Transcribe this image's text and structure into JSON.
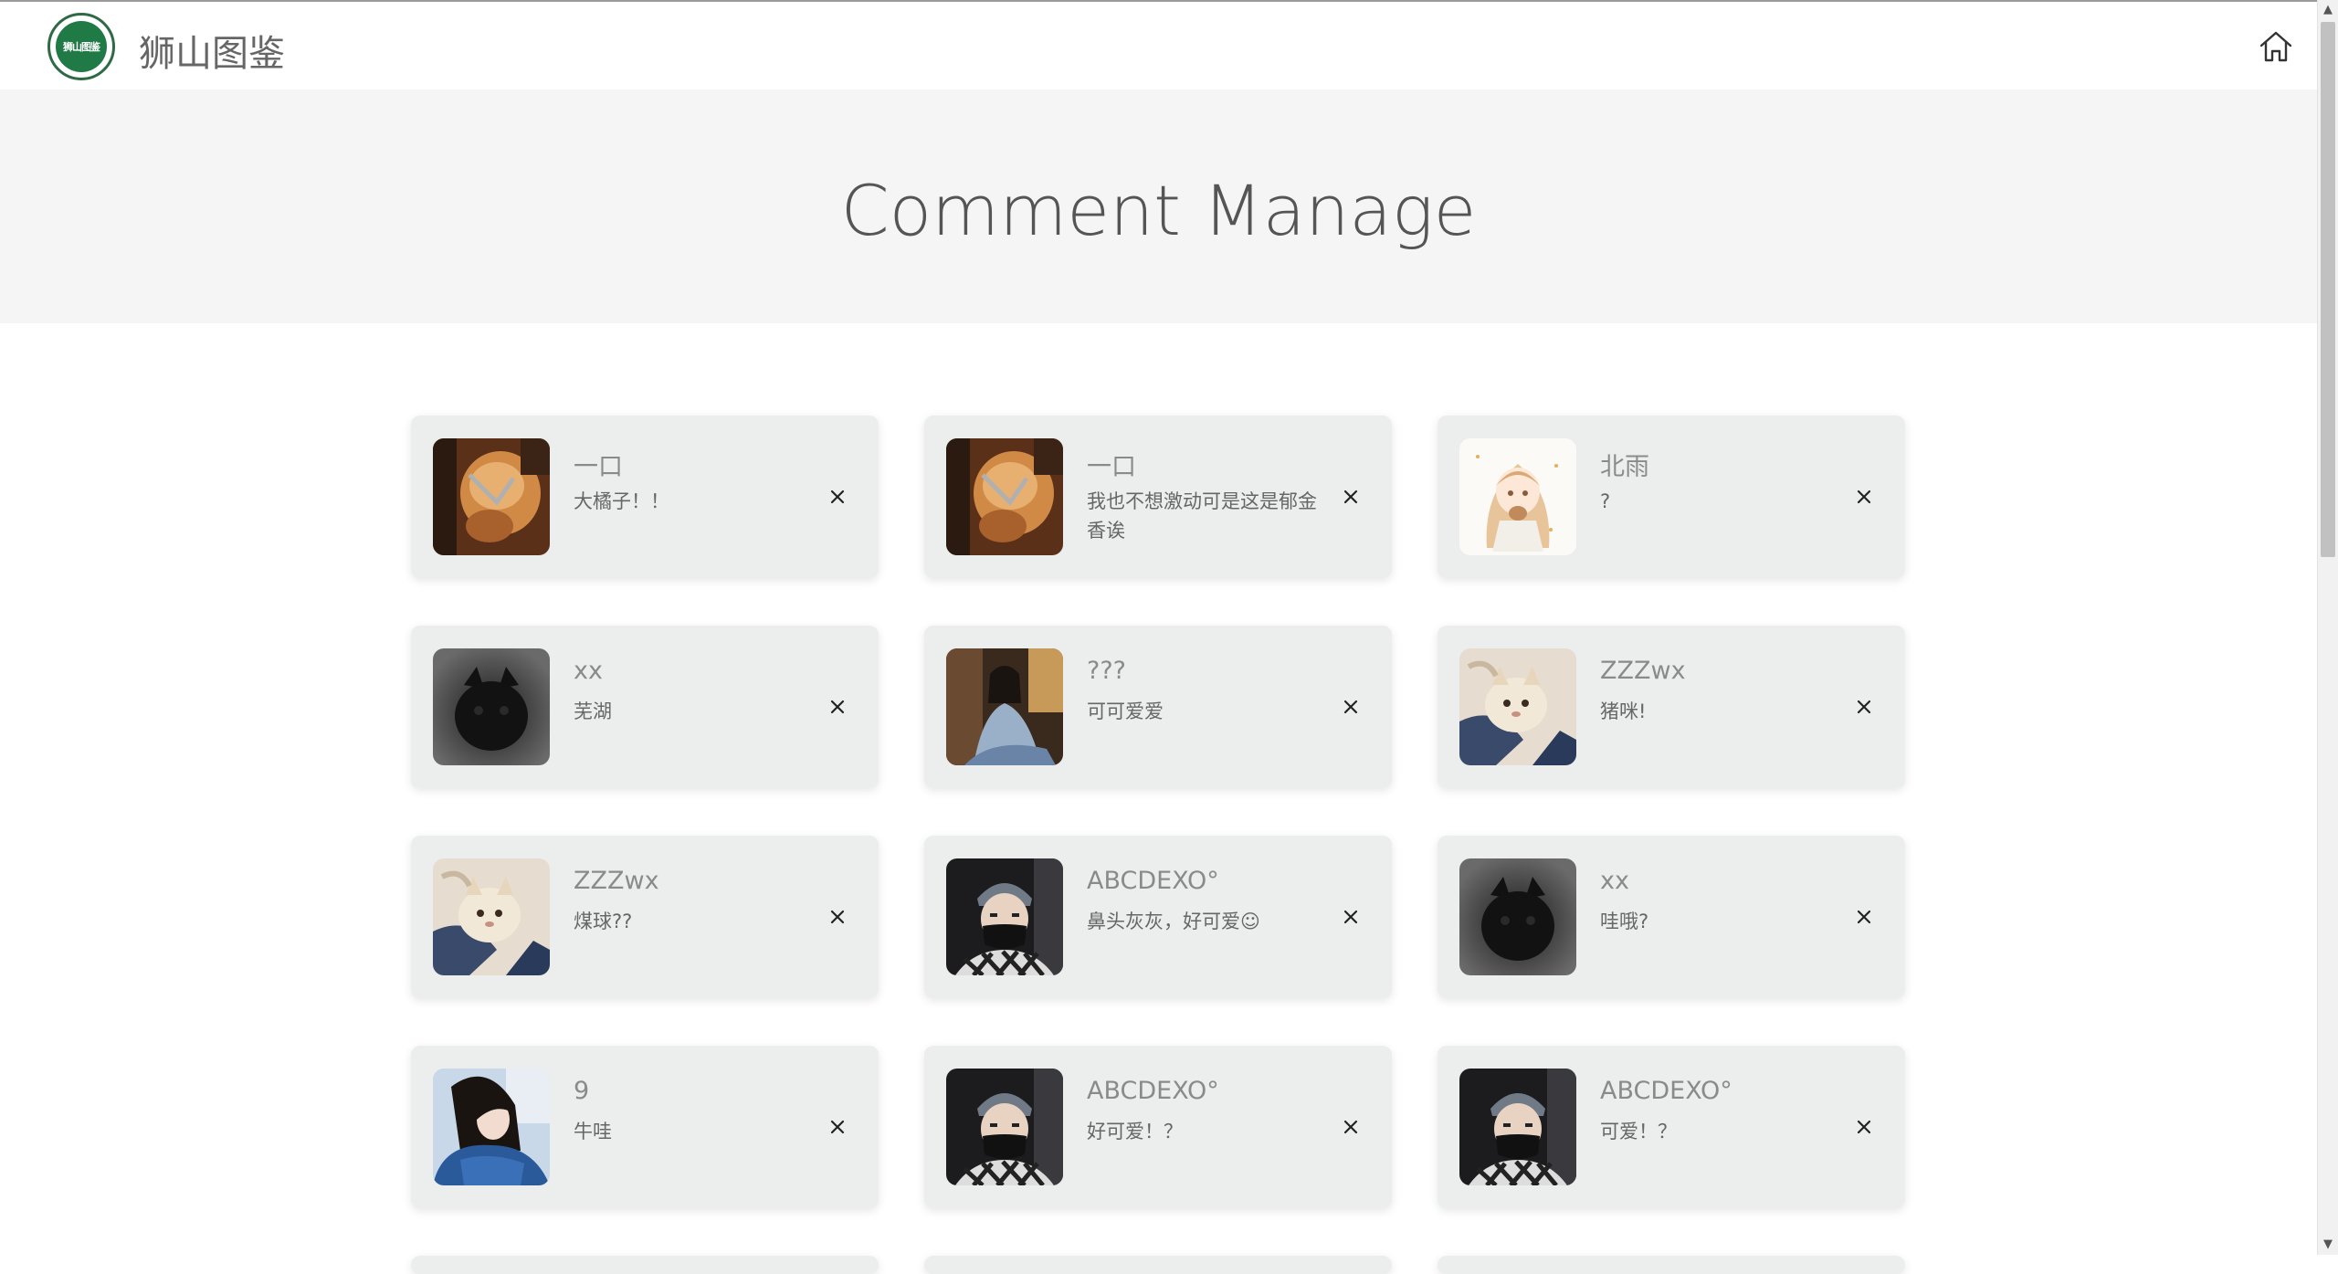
{
  "header": {
    "brand": "狮山图鉴",
    "logo_text": "狮山图鉴",
    "home_icon": "home-icon"
  },
  "hero": {
    "title": "Comment Manage"
  },
  "comments": [
    {
      "user": "一口",
      "text": "大橘子！！",
      "avatar": "orange-cat-photo"
    },
    {
      "user": "一口",
      "text": "我也不想激动可是这是郁金香诶",
      "avatar": "orange-cat-photo"
    },
    {
      "user": "北雨",
      "text": "?",
      "avatar": "anime-girl-drawing"
    },
    {
      "user": "xx",
      "text": "芜湖",
      "avatar": "black-cat-photo"
    },
    {
      "user": "???",
      "text": "可可爱爱",
      "avatar": "girl-photo"
    },
    {
      "user": "ZZZwx",
      "text": "猪咪!",
      "avatar": "cream-cat-photo"
    },
    {
      "user": "ZZZwx",
      "text": "煤球??",
      "avatar": "cream-cat-photo"
    },
    {
      "user": "ABCDEXO°",
      "text": "鼻头灰灰，好可爱☺",
      "avatar": "masked-person-photo"
    },
    {
      "user": "xx",
      "text": "哇哦?",
      "avatar": "black-cat-photo"
    },
    {
      "user": "9",
      "text": "牛哇",
      "avatar": "girl-blue-jacket-photo"
    },
    {
      "user": "ABCDEXO°",
      "text": "好可爱！？",
      "avatar": "masked-person-photo"
    },
    {
      "user": "ABCDEXO°",
      "text": "可爱！？",
      "avatar": "masked-person-photo"
    }
  ],
  "colors": {
    "accent": "#1f7a45",
    "card_bg": "#eceeed",
    "hero_bg": "#f5f5f5"
  }
}
